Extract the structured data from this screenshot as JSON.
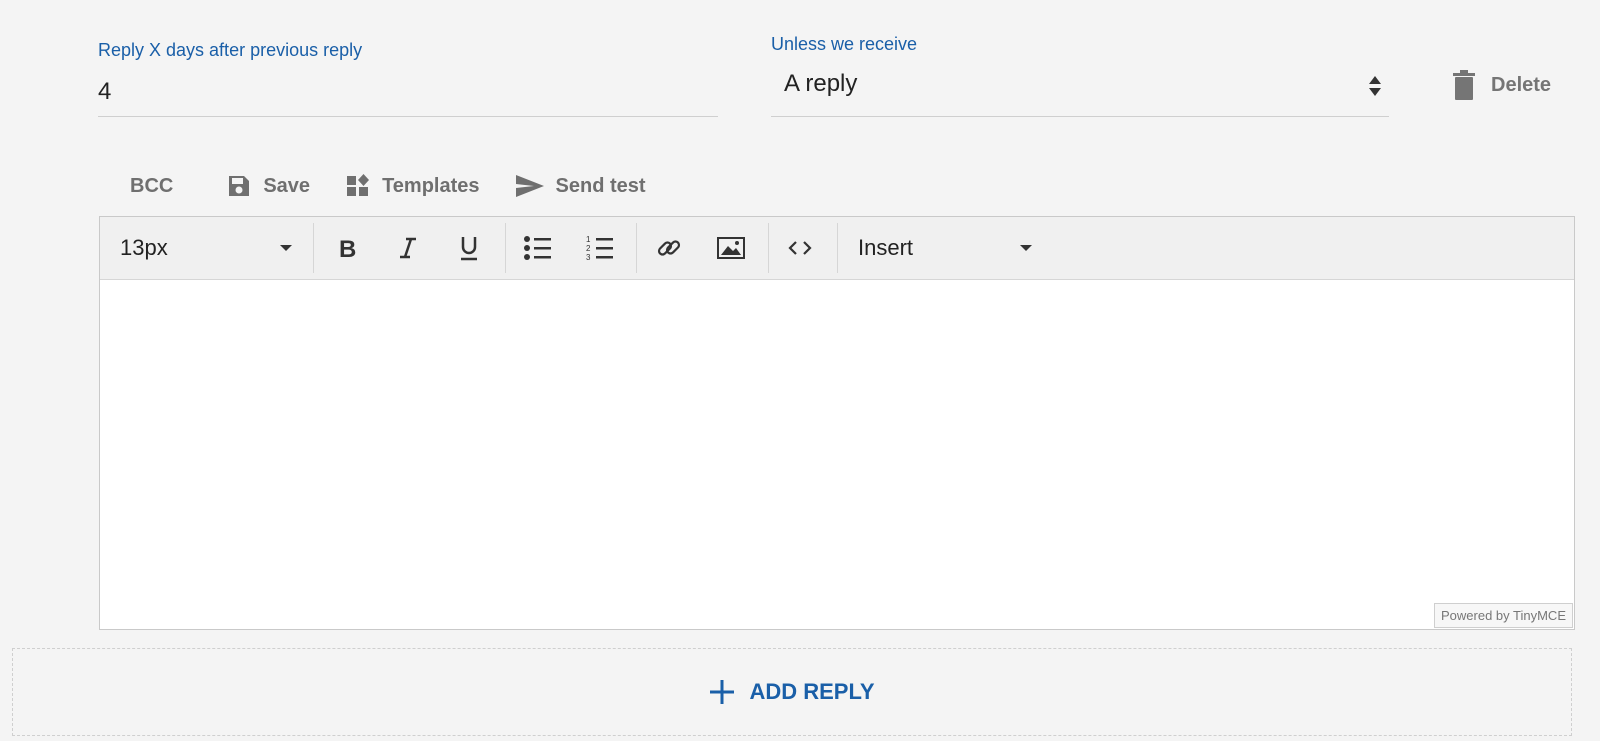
{
  "reply_days": {
    "label": "Reply X days after previous reply",
    "value": "4"
  },
  "unless": {
    "label": "Unless we receive",
    "value": "A reply"
  },
  "delete": {
    "label": "Delete"
  },
  "actions": {
    "bcc": "BCC",
    "save": "Save",
    "templates": "Templates",
    "send_test": "Send test"
  },
  "editor": {
    "font_size": "13px",
    "insert": "Insert",
    "powered_by": "Powered by TinyMCE"
  },
  "add_reply": {
    "label": "ADD REPLY"
  },
  "colors": {
    "accent": "#1a5fa8",
    "icon": "#6f6f6f",
    "background": "#f4f4f4"
  }
}
